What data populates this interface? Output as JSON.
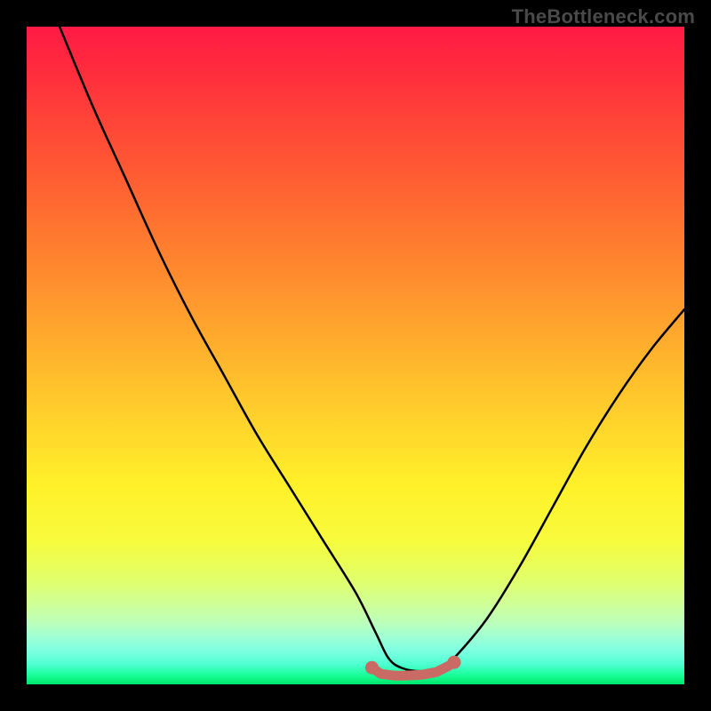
{
  "watermark": "TheBottleneck.com",
  "colors": {
    "background": "#000000",
    "gradient_top": "#ff1a45",
    "gradient_bottom": "#00e86a",
    "curve_stroke": "#000000",
    "salmon_stroke": "#c96a65",
    "salmon_fill": "#c96a65"
  },
  "chart_data": {
    "type": "line",
    "title": "",
    "xlabel": "",
    "ylabel": "",
    "xlim": [
      0,
      100
    ],
    "ylim": [
      0,
      100
    ],
    "grid": false,
    "legend": null,
    "series": [
      {
        "name": "bottleneck-curve",
        "x": [
          5,
          10,
          15,
          20,
          25,
          30,
          35,
          40,
          45,
          50,
          53,
          55,
          57,
          60,
          63,
          65,
          70,
          75,
          80,
          85,
          90,
          95,
          100
        ],
        "y": [
          100,
          88,
          77,
          66,
          56,
          47,
          38,
          30,
          22,
          14,
          8,
          4,
          2.5,
          2,
          2.5,
          4,
          10,
          18,
          27,
          36,
          44,
          51,
          57
        ]
      }
    ],
    "salmon_region": {
      "x_start": 52.5,
      "x_end": 65,
      "y_baseline": 2,
      "description": "highlighted flat bottom segment"
    }
  }
}
